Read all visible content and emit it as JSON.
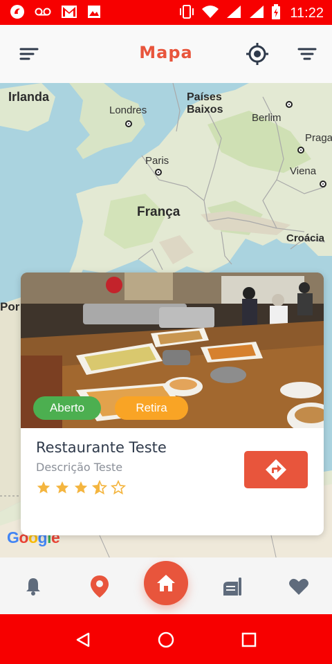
{
  "status_bar": {
    "time": "11:22",
    "icons": [
      "app-notification-icon",
      "voicemail-icon",
      "gmail-icon",
      "image-icon",
      "vibrate-icon",
      "wifi-icon",
      "signal-icon",
      "signal-icon",
      "battery-charging-icon"
    ]
  },
  "header": {
    "title": "Mapa",
    "menu_icon": "menu-icon",
    "locate_icon": "my-location-icon",
    "filter_icon": "filter-icon"
  },
  "map": {
    "labels": {
      "irlanda": "Irlanda",
      "londres": "Londres",
      "paises_baixos_1": "Países",
      "paises_baixos_2": "Baixos",
      "berlim": "Berlim",
      "praga": "Praga",
      "paris": "Paris",
      "viena": "Viena",
      "franca": "França",
      "croacia": "Croácia",
      "portugal_partial": "Por"
    },
    "attribution": "Google"
  },
  "card": {
    "status_open": "Aberto",
    "status_pickup": "Retira",
    "name": "Restaurante Teste",
    "description": "Descrição Teste",
    "rating": 3.5,
    "rating_max": 5,
    "route_icon": "directions-icon"
  },
  "bottom_nav": {
    "items": [
      "bell-icon",
      "location-pin-icon",
      "home-icon",
      "menu-book-icon",
      "heart-icon"
    ],
    "active": "home-icon"
  },
  "system_nav": {
    "items": [
      "back-icon",
      "home-circle-icon",
      "recents-icon"
    ]
  },
  "colors": {
    "accent": "#e8553c",
    "status_bar": "#f70000",
    "open_badge": "#4caf50",
    "pickup_badge": "#f9a425",
    "star": "#f4b53f",
    "nav_icon": "#5f6b7c"
  }
}
